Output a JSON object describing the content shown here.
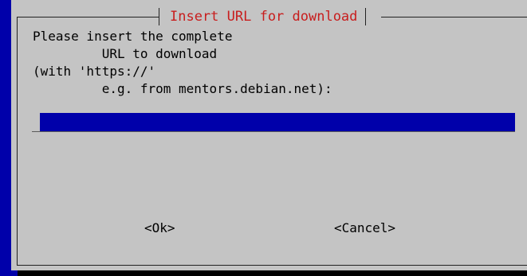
{
  "dialog": {
    "title": "Insert URL for download",
    "prompt": "Please insert the complete\n         URL to download\n(with 'https://'\n         e.g. from mentors.debian.net):",
    "input_value": ""
  },
  "buttons": {
    "ok_label": "<Ok>",
    "cancel_label": "<Cancel>"
  },
  "colors": {
    "background": "#0000aa",
    "dialog": "#c4c4c4",
    "title": "#c81d1d",
    "input": "#0000aa"
  }
}
